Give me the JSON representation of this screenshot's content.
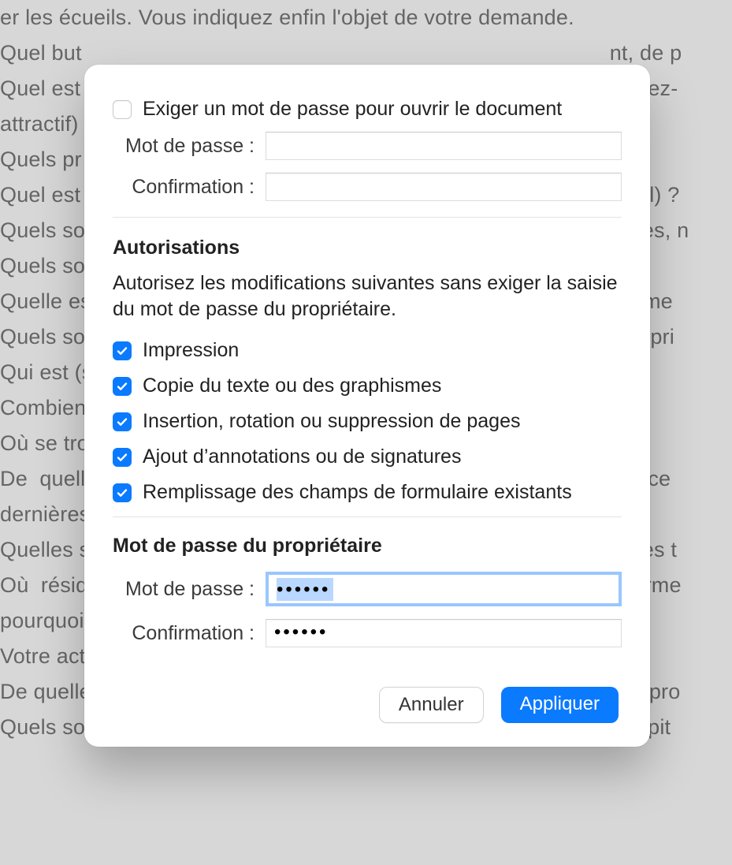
{
  "background": {
    "lines": [
      "er les écueils. Vous indiquez enfin l'objet de votre demande.",
      "",
      "Quel but                                                                                       nt, de p",
      "Quel est                                                                                     évoluez-",
      "attractif)",
      "Quels pr",
      "Quel est                                                                                        ntiel) ?",
      "Quels so                                                                                      prises, n",
      "Quels so",
      "Quelle es                                                                                   oppeme",
      "Quels so                                                                                     entrepri",
      "Qui est (s",
      "Combien",
      "Où se tro",
      "De  quelle                                                                                   énéfice",
      "dernières",
      "Quelles s                                                                                    our les t",
      "Où  réside                                                                                  s  perme",
      "pourquoi",
      "Votre act",
      "De quelle                                                                                   votre pro",
      "Quels so                                                                                    de capit"
    ]
  },
  "openPassword": {
    "checkbox_checked": false,
    "require_label": "Exiger un mot de passe pour ouvrir le document",
    "password_label": "Mot de passe :",
    "password_value": "",
    "confirm_label": "Confirmation :",
    "confirm_value": ""
  },
  "permissions": {
    "title": "Autorisations",
    "desc": "Autorisez les modifications suivantes sans exiger la saisie du mot de passe du propriétaire.",
    "items": [
      {
        "label": "Impression",
        "checked": true
      },
      {
        "label": "Copie du texte ou des graphismes",
        "checked": true
      },
      {
        "label": "Insertion, rotation ou suppression de pages",
        "checked": true
      },
      {
        "label": "Ajout d’annotations ou de signatures",
        "checked": true
      },
      {
        "label": "Remplissage des champs de formulaire existants",
        "checked": true
      }
    ]
  },
  "ownerPassword": {
    "title": "Mot de passe du propriétaire",
    "password_label": "Mot de passe :",
    "password_value": "••••••",
    "confirm_label": "Confirmation :",
    "confirm_value": "••••••"
  },
  "buttons": {
    "cancel": "Annuler",
    "apply": "Appliquer"
  }
}
